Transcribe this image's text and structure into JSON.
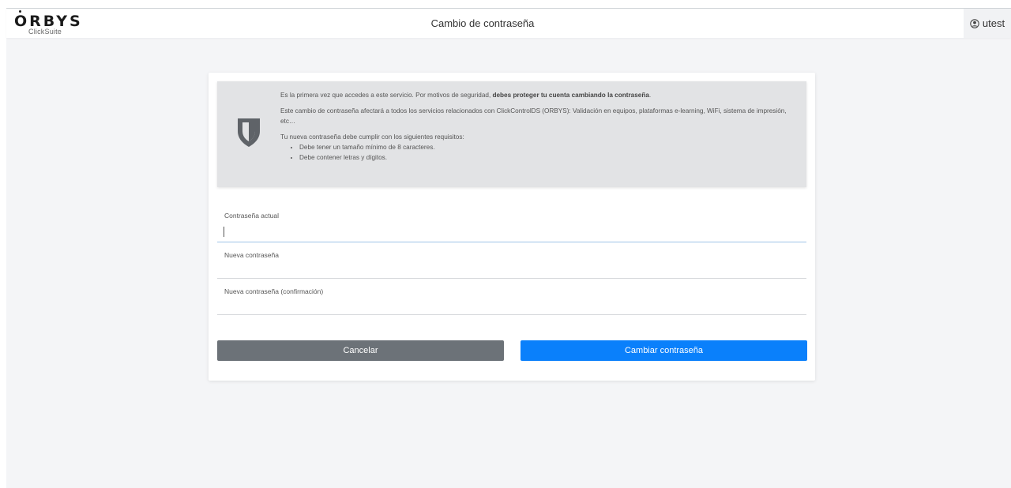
{
  "header": {
    "logo_text": "ORBYS",
    "logo_subtext": "ClickSuite",
    "title": "Cambio de contraseña",
    "user_name": "utest",
    "user_icon": "user-circle-icon"
  },
  "notice": {
    "icon": "shield-icon",
    "intro_prefix": "Es la primera vez que accedes a este servicio. Por motivos de seguridad, ",
    "intro_bold": "debes proteger tu cuenta cambiando la contraseña",
    "intro_suffix": ".",
    "scope": "Este cambio de contraseña afectará a todos los servicios relacionados con ClickControlDS (ORBYS): Validación en equipos, plataformas e-learning, WiFi, sistema de impresión, etc…",
    "requirements_title": "Tu nueva contraseña debe cumplir con los siguientes requisitos:",
    "requirements": [
      "Debe tener un tamaño mínimo de 8 caracteres.",
      "Debe contener letras y dígitos."
    ]
  },
  "form": {
    "current_password_label": "Contraseña actual",
    "current_password_value": "",
    "new_password_label": "Nueva contraseña",
    "new_password_value": "",
    "confirm_password_label": "Nueva contraseña (confirmación)",
    "confirm_password_value": ""
  },
  "actions": {
    "cancel_label": "Cancelar",
    "submit_label": "Cambiar contraseña"
  },
  "colors": {
    "primary": "#0a80fb",
    "secondary": "#6c7278",
    "notice_bg": "#e2e3e5"
  }
}
